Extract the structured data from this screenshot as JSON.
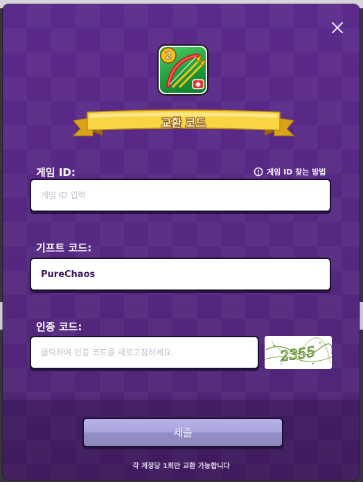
{
  "dialog": {
    "title": "교환 코드",
    "close_icon": "close-icon",
    "app_icon": "bow-arrow-game-icon",
    "app_icon_badge": "2"
  },
  "fields": {
    "game_id": {
      "label": "게임 ID:",
      "placeholder": "게임 ID 입력",
      "value": ""
    },
    "help_link": {
      "label": "게임 ID 찾는 방법",
      "icon": "info-circle-icon"
    },
    "gift_code": {
      "label": "기프트 코드:",
      "value": "PureChaos"
    },
    "captcha": {
      "label": "인증 코드:",
      "placeholder": "클릭하여 인증 코드를 새로고침하세요.",
      "value": "",
      "image_text": "2355"
    }
  },
  "actions": {
    "submit_label": "제출"
  },
  "footer": {
    "note": "각 계정당 1회만 교환 가능합니다"
  },
  "colors": {
    "modal_bg": "#5a2a86",
    "ribbon": "#f6cf3a",
    "submit_bg": "#aaa7dd",
    "field_border": "#1c1030"
  }
}
